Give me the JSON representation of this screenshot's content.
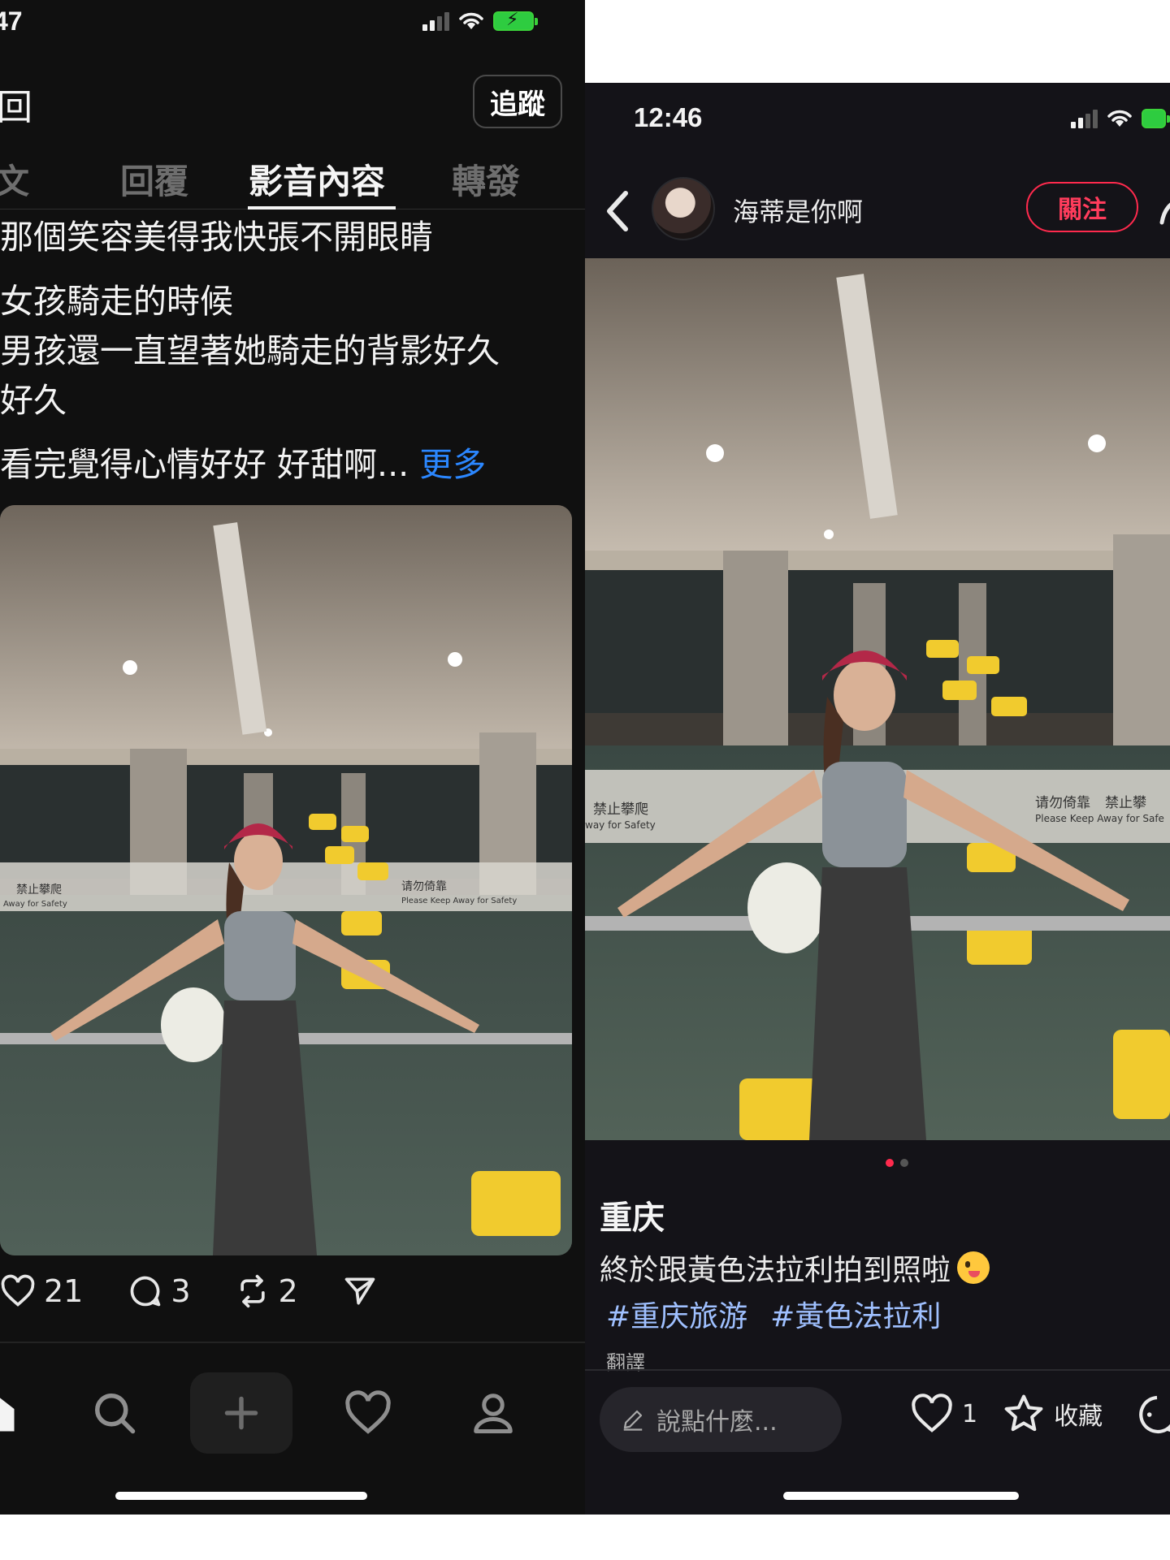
{
  "left": {
    "status_time": "47",
    "back_title": "回",
    "follow_button": "追蹤",
    "tabs": [
      {
        "label": "文"
      },
      {
        "label": "回覆"
      },
      {
        "label": "影音內容"
      },
      {
        "label": "轉發"
      }
    ],
    "active_tab": "影音內容",
    "post_lines": [
      "那個笑容美得我快張不開眼睛",
      "女孩騎走的時候",
      "男孩還一直望著她騎走的背影好久",
      "好久",
      "看完覺得心情好好 好甜啊..."
    ],
    "more_label": "更多",
    "stats": {
      "likes": "21",
      "comments": "3",
      "reposts": "2"
    },
    "photo_signs": {
      "no_climb": "禁止攀爬",
      "keep_away": "请勿倚靠",
      "keep_away_en": "Please Keep Away for Safety",
      "away_for_safety": "Away for Safety"
    },
    "nav_icons": [
      "home-icon",
      "search-icon",
      "plus-icon",
      "heart-icon",
      "profile-icon"
    ]
  },
  "right": {
    "status_time": "12:46",
    "username": "海蒂是你啊",
    "follow_button": "關注",
    "carousel_index": 1,
    "carousel_total": 2,
    "title": "重庆",
    "description": "終於跟黃色法拉利拍到照啦",
    "tags": [
      "#重庆旅游",
      "#黃色法拉利"
    ],
    "translate_label": "翻譯",
    "comment_placeholder": "說點什麼...",
    "like_count": "1",
    "collect_label": "收藏",
    "photo_signs": {
      "no_climb": "禁止攀爬",
      "keep_away": "请勿倚靠",
      "keep_away_en": "Please Keep Away for Safe",
      "away_for_safety": "way for Safety",
      "no_climb_right": "禁止攀"
    }
  },
  "colors": {
    "left_bg": "#101010",
    "right_bg": "#141318",
    "link_blue": "#2b87ff",
    "accent_red": "#ff2a4d",
    "battery_green": "#2ecc40"
  }
}
